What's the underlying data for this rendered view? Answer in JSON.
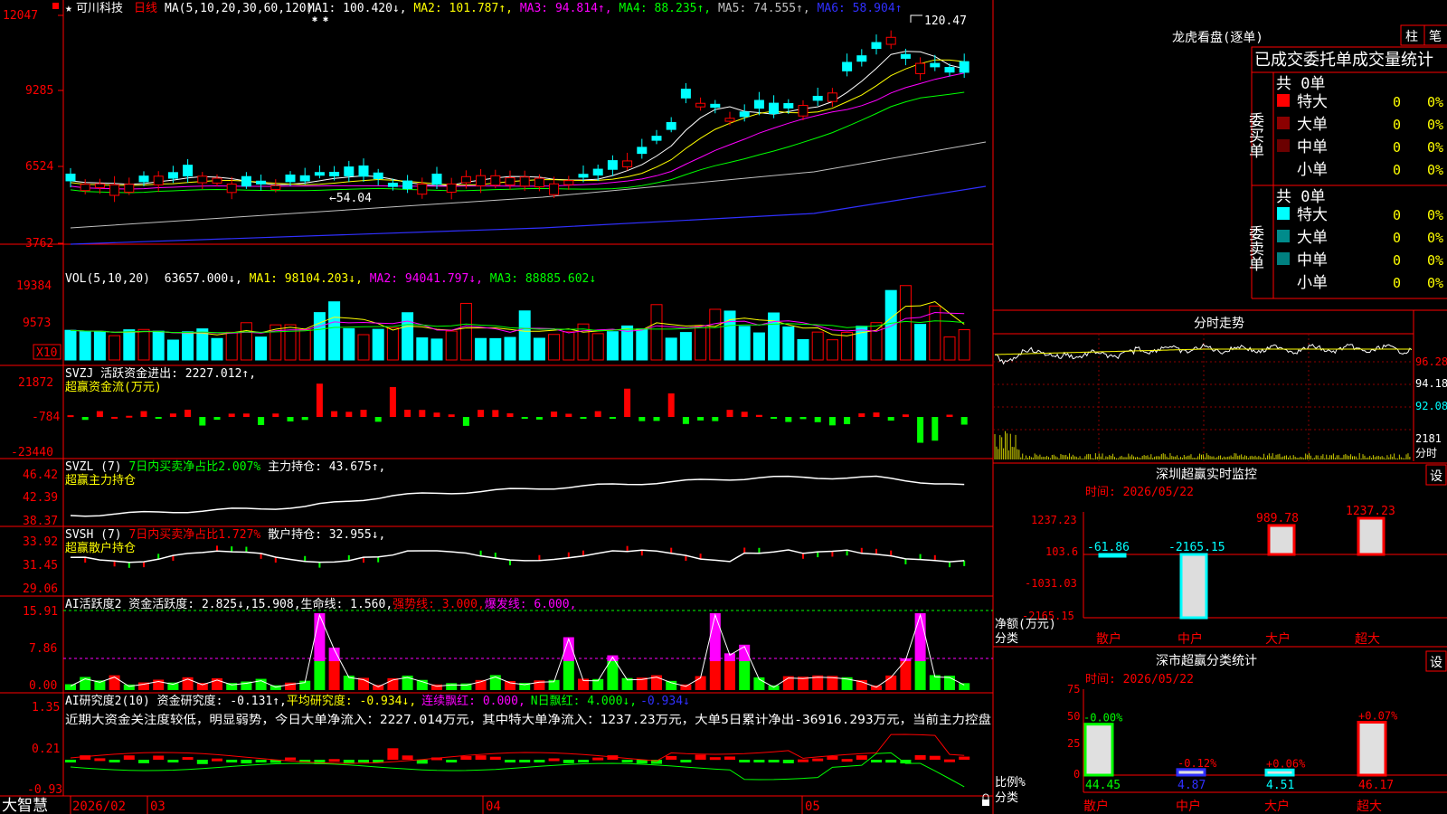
{
  "colors": {
    "up": "#ff0000",
    "down": "#00ffff",
    "grid": "#8b0000",
    "axis": "#ff0000",
    "white": "#ffffff",
    "yellow": "#ffff00",
    "magenta": "#ff00ff",
    "green": "#00ff00",
    "blue": "#3030ff",
    "gray": "#c0c0c0",
    "cyan": "#00ffff"
  },
  "main": {
    "star": "★",
    "stock_name": "可川科技",
    "period": "日线",
    "ma_label": "MA(5,10,20,30,60,120)",
    "ma_values": [
      {
        "text": "MA1: 100.420↓,",
        "color": "#ffffff"
      },
      {
        "text": "MA2: 101.787↑,",
        "color": "#ffff00"
      },
      {
        "text": "MA3: 94.814↑,",
        "color": "#ff00ff"
      },
      {
        "text": "MA4: 88.235↑,",
        "color": "#00ff00"
      },
      {
        "text": "MA5: 74.555↑,",
        "color": "#c0c0c0"
      },
      {
        "text": "MA6: 58.904↑",
        "color": "#3030ff"
      }
    ],
    "y_ticks": [
      "12047",
      "9285",
      "6524",
      "3762"
    ],
    "high_label": "120.47",
    "low_label": "←54.04"
  },
  "vol": {
    "label": "VOL(5,10,20)",
    "value": "63657.000↓,",
    "mas": [
      {
        "text": "MA1: 98104.203↓,",
        "color": "#ffff00"
      },
      {
        "text": "MA2: 94041.797↓,",
        "color": "#ff00ff"
      },
      {
        "text": "MA3: 88885.602↓",
        "color": "#00ff00"
      }
    ],
    "y_ticks": [
      "19384",
      "9573"
    ],
    "unit": "X10"
  },
  "svzj": {
    "title": "SVZJ  活跃资金进出: 2227.012↑,",
    "sub": "超赢资金流(万元)",
    "y_ticks": [
      "21872",
      "-784",
      "-23440"
    ]
  },
  "svzl": {
    "title_a": "SVZL (7) ",
    "title_b": "7日内买卖净占比2.007%",
    "title_c": " 主力持仓: 43.675↑,",
    "sub": "超赢主力持仓",
    "y_ticks": [
      "46.42",
      "42.39",
      "38.37"
    ]
  },
  "svsh": {
    "title_a": "SVSH (7) ",
    "title_b": "7日内买卖净占比1.727%",
    "title_c": " 散户持仓: 32.955↓,",
    "sub": "超赢散户持仓",
    "y_ticks": [
      "33.92",
      "31.45",
      "29.06"
    ]
  },
  "ai_active": {
    "title": "AI活跃度2 资金活跃度: 2.825↓,15.908,生命线: 1.560,",
    "strong": "强势线: 3.000,",
    "burst": "爆发线: 6.000,",
    "y_ticks": [
      "15.91",
      "7.86",
      "0.00"
    ]
  },
  "ai_research": {
    "title_a": "AI研究度2(10) 资金研究度: -0.131↑,",
    "title_b": "平均研究度: -0.934↓,",
    "title_c": "连续飘红: 0.000,",
    "title_d": "N日飘红: 4.000↓,",
    "title_e": "-0.934↓",
    "commentary": "近期大资金关注度较低，明显弱势，今日大单净流入：2227.014万元，其中特大单净流入：1237.23万元，大单5日累计净出-36916.293万元，当前主力控盘",
    "y_ticks": [
      "1.35",
      "0.21",
      "-0.93"
    ]
  },
  "time_axis": {
    "brand": "大智慧",
    "labels": [
      "2026/02",
      "03",
      "04",
      "05"
    ]
  },
  "dragon_tiger": {
    "title": "龙虎看盘(逐单)",
    "tab1": "柱",
    "tab2": "笔",
    "header": "已成交委托单成交量统计",
    "buy_label": "委买单",
    "sell_label": "委卖单",
    "buy_total": "共 0单",
    "sell_total": "共 0单",
    "buy_rows": [
      {
        "name": "特大",
        "count": "0",
        "pct": "0%",
        "color": "#ff0000"
      },
      {
        "name": "大单",
        "count": "0",
        "pct": "0%",
        "color": "#8b0000"
      },
      {
        "name": "中单",
        "count": "0",
        "pct": "0%",
        "color": "#6b0000"
      },
      {
        "name": "小单",
        "count": "0",
        "pct": "0%",
        "color": "#000000"
      }
    ],
    "sell_rows": [
      {
        "name": "特大",
        "count": "0",
        "pct": "0%",
        "color": "#00ffff"
      },
      {
        "name": "大单",
        "count": "0",
        "pct": "0%",
        "color": "#008b8b"
      },
      {
        "name": "中单",
        "count": "0",
        "pct": "0%",
        "color": "#008080"
      },
      {
        "name": "小单",
        "count": "0",
        "pct": "0%",
        "color": "#000000"
      }
    ]
  },
  "intraday": {
    "title": "分时走势",
    "y_ticks": [
      "96.28",
      "94.18",
      "92.08"
    ],
    "vol_tick": "2181",
    "vol_unit": "分时"
  },
  "monitor": {
    "title": "深圳超赢实时监控",
    "set": "设",
    "date": "时间: 2026/05/22",
    "y_ticks": [
      "1237.23",
      "103.6",
      "-1031.03",
      "-2165.15"
    ],
    "y_label_1": "净额(万元)",
    "y_label_2": "分类",
    "chart_data": {
      "type": "bar",
      "categories": [
        "散户",
        "中户",
        "大户",
        "超大"
      ],
      "values": [
        -61.86,
        -2165.15,
        989.78,
        1237.23
      ],
      "labels": [
        "-61.86",
        "-2165.15",
        "989.78",
        "1237.23"
      ],
      "ylim": [
        -2165.15,
        1237.23
      ]
    }
  },
  "classify": {
    "title": "深市超赢分类统计",
    "set": "设",
    "date": "时间: 2026/05/22",
    "y_ticks": [
      "75",
      "50",
      "25",
      "0"
    ],
    "y_label_1": "比例%",
    "y_label_2": "分类",
    "chart_data": {
      "type": "bar",
      "categories": [
        "散户",
        "中户",
        "大户",
        "超大"
      ],
      "values": [
        44.45,
        4.87,
        4.51,
        46.17
      ],
      "changes": [
        "-0.00%",
        "-0.12%",
        "+0.06%",
        "+0.07%"
      ],
      "value_labels": [
        "44.45",
        "4.87",
        "4.51",
        "46.17"
      ],
      "ylim": [
        0,
        75
      ]
    }
  }
}
